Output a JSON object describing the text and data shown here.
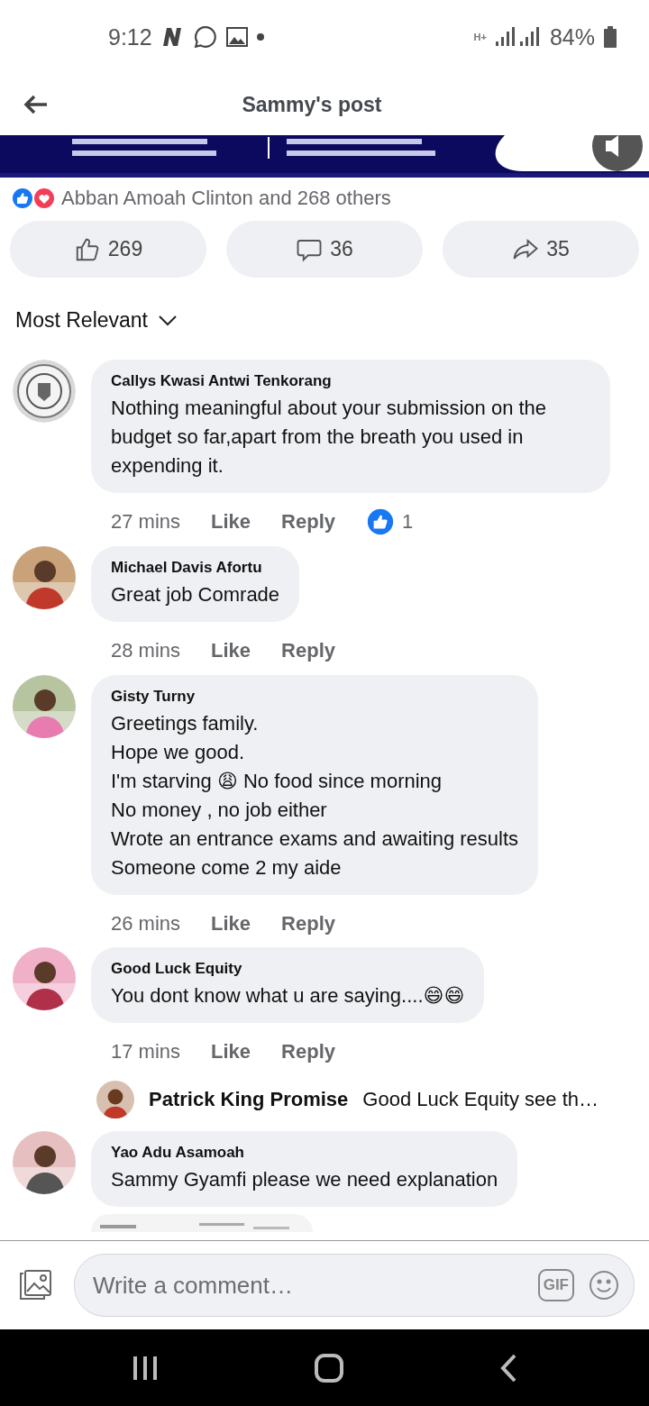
{
  "status_bar": {
    "time": "9:12",
    "network": "H+",
    "battery": "84%"
  },
  "header": {
    "title": "Sammy's post"
  },
  "reactions": {
    "summary": "Abban Amoah Clinton and 268 others"
  },
  "actions": [
    {
      "kind": "like",
      "count": "269"
    },
    {
      "kind": "comment",
      "count": "36"
    },
    {
      "kind": "share",
      "count": "35"
    }
  ],
  "sort": {
    "label": "Most Relevant"
  },
  "comments": [
    {
      "author": "Callys Kwasi Antwi Tenkorang",
      "text": "Nothing meaningful about your submission on the budget so far,apart from the breath you used in expending it.",
      "time": "27 mins",
      "like": "Like",
      "reply": "Reply",
      "likes": "1"
    },
    {
      "author": "Michael Davis Afortu",
      "text": "Great job Comrade",
      "time": "28 mins",
      "like": "Like",
      "reply": "Reply"
    },
    {
      "author": "Gisty Turny",
      "text": "Greetings family.\nHope we good.\nI'm starving 😩  No food since morning\nNo money , no job either\nWrote an entrance exams and awaiting results\nSomeone come 2 my aide",
      "time": "26 mins",
      "like": "Like",
      "reply": "Reply"
    },
    {
      "author": "Good Luck Equity",
      "text": "You dont know what u are saying....😄😄",
      "time": "17 mins",
      "like": "Like",
      "reply": "Reply",
      "reply_preview": {
        "author": "Patrick King Promise",
        "text": "Good Luck Equity see th…"
      }
    },
    {
      "author": "Yao Adu Asamoah",
      "text": "Sammy Gyamfi please we need explanation"
    }
  ],
  "composer": {
    "placeholder": "Write a comment…",
    "gif": "GIF"
  }
}
